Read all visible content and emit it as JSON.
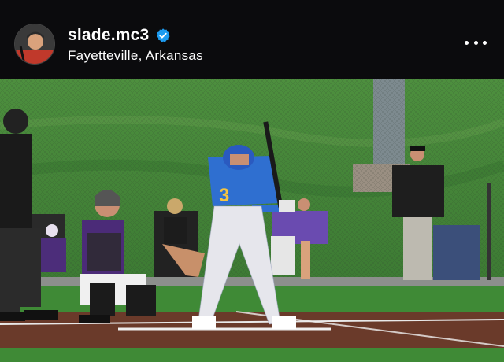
{
  "post_header": {
    "username": "slade.mc3",
    "location": "Fayetteville, Arkansas",
    "verified": true,
    "avatar_icon": "profile-avatar",
    "more_icon": "more-options-icon"
  },
  "photo": {
    "jersey_number": "3"
  },
  "colors": {
    "header_bg": "#0b0b0d",
    "verified_blue": "#1d9bf0",
    "grass": "#3f8a36",
    "dirt": "#6a3a2a",
    "jersey_blue": "#2f6fd0"
  }
}
